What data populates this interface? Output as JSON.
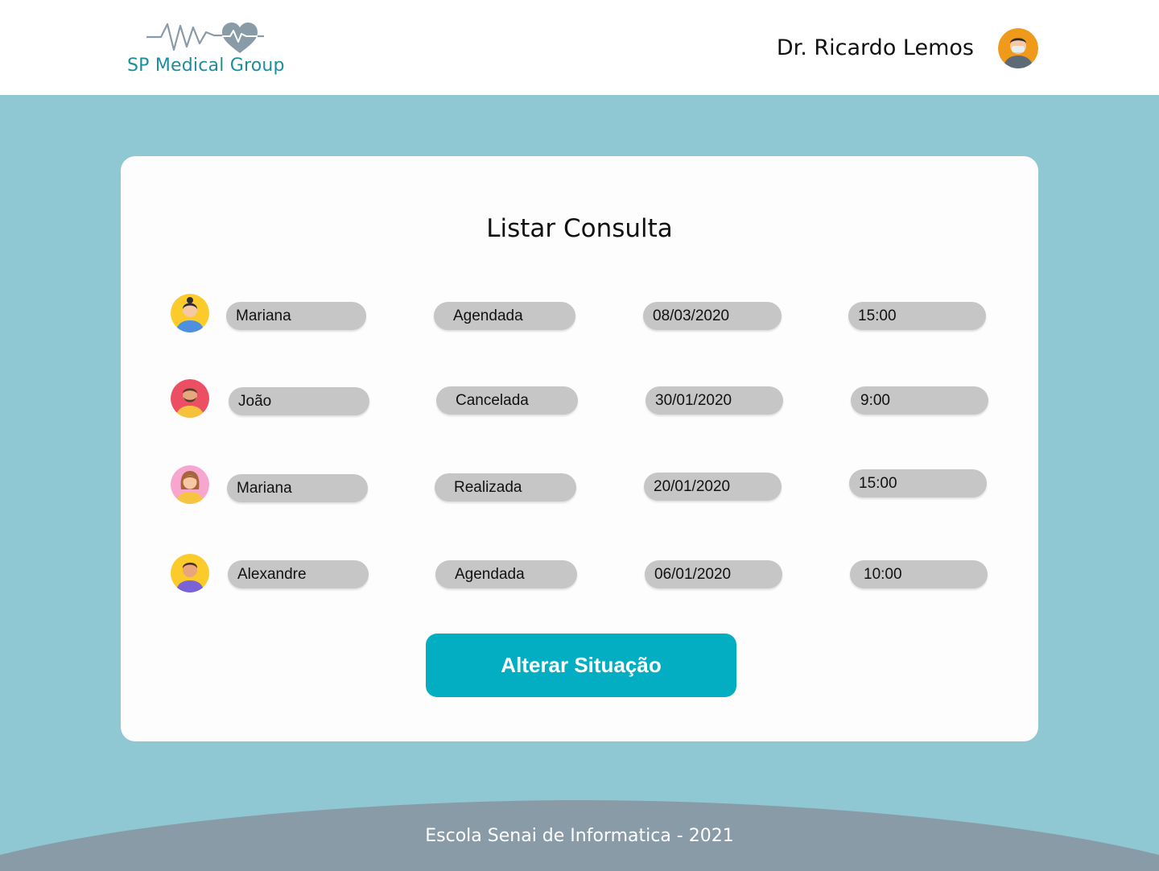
{
  "header": {
    "brand": "SP Medical Group",
    "user_name": "Dr. Ricardo Lemos",
    "logo_icon": "heartbeat-heart-icon",
    "avatar_icon": "doctor-avatar-icon"
  },
  "main": {
    "title": "Listar Consulta",
    "consultas": [
      {
        "paciente": "Mariana",
        "situacao": "Agendada",
        "data": "08/03/2020",
        "hora": "15:00",
        "avatar": "female-patient-avatar-icon"
      },
      {
        "paciente": "João",
        "situacao": "Cancelada",
        "data": "30/01/2020",
        "hora": "9:00",
        "avatar": "male-patient-avatar-icon"
      },
      {
        "paciente": "Mariana",
        "situacao": "Realizada",
        "data": "20/01/2020",
        "hora": "15:00",
        "avatar": "female-patient-avatar-icon"
      },
      {
        "paciente": "Alexandre",
        "situacao": "Agendada",
        "data": "06/01/2020",
        "hora": "10:00",
        "avatar": "male-patient-avatar-icon"
      }
    ],
    "action_label": "Alterar Situação"
  },
  "footer": {
    "text": "Escola Senai de Informatica - 2021"
  },
  "colors": {
    "page_background": "#8fc7d2",
    "brand": "#1b8ea0",
    "button": "#04aec2",
    "pill": "#c6c6c6",
    "footer": "#8a9ba8"
  }
}
